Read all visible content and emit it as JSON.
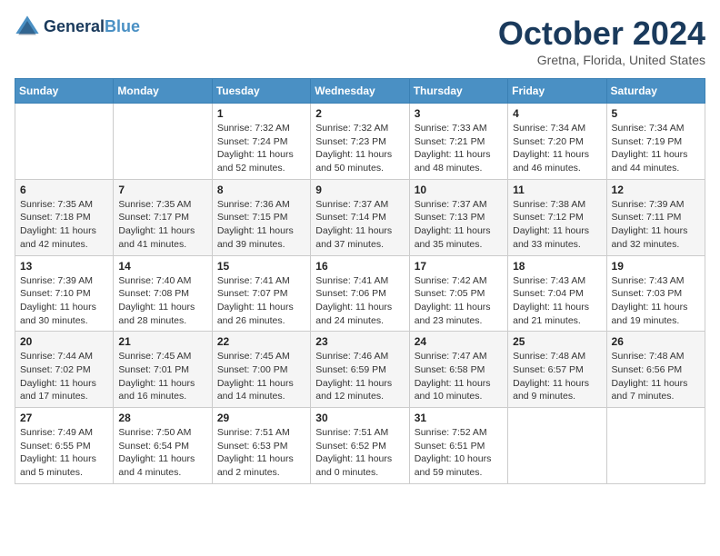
{
  "header": {
    "logo_line1": "General",
    "logo_line2": "Blue",
    "month_title": "October 2024",
    "location": "Gretna, Florida, United States"
  },
  "weekdays": [
    "Sunday",
    "Monday",
    "Tuesday",
    "Wednesday",
    "Thursday",
    "Friday",
    "Saturday"
  ],
  "weeks": [
    [
      null,
      null,
      {
        "day": 1,
        "sunrise": "7:32 AM",
        "sunset": "7:24 PM",
        "daylight": "11 hours and 52 minutes."
      },
      {
        "day": 2,
        "sunrise": "7:32 AM",
        "sunset": "7:23 PM",
        "daylight": "11 hours and 50 minutes."
      },
      {
        "day": 3,
        "sunrise": "7:33 AM",
        "sunset": "7:21 PM",
        "daylight": "11 hours and 48 minutes."
      },
      {
        "day": 4,
        "sunrise": "7:34 AM",
        "sunset": "7:20 PM",
        "daylight": "11 hours and 46 minutes."
      },
      {
        "day": 5,
        "sunrise": "7:34 AM",
        "sunset": "7:19 PM",
        "daylight": "11 hours and 44 minutes."
      }
    ],
    [
      {
        "day": 6,
        "sunrise": "7:35 AM",
        "sunset": "7:18 PM",
        "daylight": "11 hours and 42 minutes."
      },
      {
        "day": 7,
        "sunrise": "7:35 AM",
        "sunset": "7:17 PM",
        "daylight": "11 hours and 41 minutes."
      },
      {
        "day": 8,
        "sunrise": "7:36 AM",
        "sunset": "7:15 PM",
        "daylight": "11 hours and 39 minutes."
      },
      {
        "day": 9,
        "sunrise": "7:37 AM",
        "sunset": "7:14 PM",
        "daylight": "11 hours and 37 minutes."
      },
      {
        "day": 10,
        "sunrise": "7:37 AM",
        "sunset": "7:13 PM",
        "daylight": "11 hours and 35 minutes."
      },
      {
        "day": 11,
        "sunrise": "7:38 AM",
        "sunset": "7:12 PM",
        "daylight": "11 hours and 33 minutes."
      },
      {
        "day": 12,
        "sunrise": "7:39 AM",
        "sunset": "7:11 PM",
        "daylight": "11 hours and 32 minutes."
      }
    ],
    [
      {
        "day": 13,
        "sunrise": "7:39 AM",
        "sunset": "7:10 PM",
        "daylight": "11 hours and 30 minutes."
      },
      {
        "day": 14,
        "sunrise": "7:40 AM",
        "sunset": "7:08 PM",
        "daylight": "11 hours and 28 minutes."
      },
      {
        "day": 15,
        "sunrise": "7:41 AM",
        "sunset": "7:07 PM",
        "daylight": "11 hours and 26 minutes."
      },
      {
        "day": 16,
        "sunrise": "7:41 AM",
        "sunset": "7:06 PM",
        "daylight": "11 hours and 24 minutes."
      },
      {
        "day": 17,
        "sunrise": "7:42 AM",
        "sunset": "7:05 PM",
        "daylight": "11 hours and 23 minutes."
      },
      {
        "day": 18,
        "sunrise": "7:43 AM",
        "sunset": "7:04 PM",
        "daylight": "11 hours and 21 minutes."
      },
      {
        "day": 19,
        "sunrise": "7:43 AM",
        "sunset": "7:03 PM",
        "daylight": "11 hours and 19 minutes."
      }
    ],
    [
      {
        "day": 20,
        "sunrise": "7:44 AM",
        "sunset": "7:02 PM",
        "daylight": "11 hours and 17 minutes."
      },
      {
        "day": 21,
        "sunrise": "7:45 AM",
        "sunset": "7:01 PM",
        "daylight": "11 hours and 16 minutes."
      },
      {
        "day": 22,
        "sunrise": "7:45 AM",
        "sunset": "7:00 PM",
        "daylight": "11 hours and 14 minutes."
      },
      {
        "day": 23,
        "sunrise": "7:46 AM",
        "sunset": "6:59 PM",
        "daylight": "11 hours and 12 minutes."
      },
      {
        "day": 24,
        "sunrise": "7:47 AM",
        "sunset": "6:58 PM",
        "daylight": "11 hours and 10 minutes."
      },
      {
        "day": 25,
        "sunrise": "7:48 AM",
        "sunset": "6:57 PM",
        "daylight": "11 hours and 9 minutes."
      },
      {
        "day": 26,
        "sunrise": "7:48 AM",
        "sunset": "6:56 PM",
        "daylight": "11 hours and 7 minutes."
      }
    ],
    [
      {
        "day": 27,
        "sunrise": "7:49 AM",
        "sunset": "6:55 PM",
        "daylight": "11 hours and 5 minutes."
      },
      {
        "day": 28,
        "sunrise": "7:50 AM",
        "sunset": "6:54 PM",
        "daylight": "11 hours and 4 minutes."
      },
      {
        "day": 29,
        "sunrise": "7:51 AM",
        "sunset": "6:53 PM",
        "daylight": "11 hours and 2 minutes."
      },
      {
        "day": 30,
        "sunrise": "7:51 AM",
        "sunset": "6:52 PM",
        "daylight": "11 hours and 0 minutes."
      },
      {
        "day": 31,
        "sunrise": "7:52 AM",
        "sunset": "6:51 PM",
        "daylight": "10 hours and 59 minutes."
      },
      null,
      null
    ]
  ]
}
